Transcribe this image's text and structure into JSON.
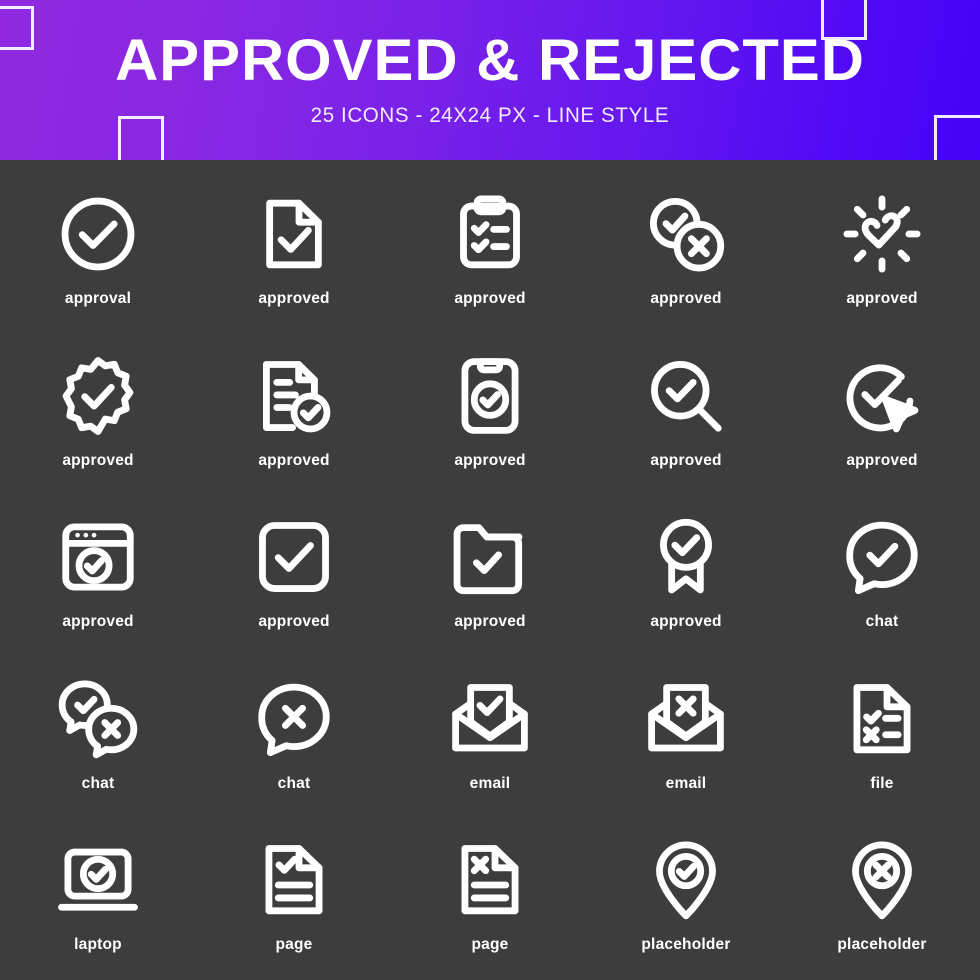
{
  "header": {
    "title": "APPROVED & REJECTED",
    "subtitle": "25 ICONS - 24X24 PX - LINE STYLE",
    "gradient_start": "#9029e0",
    "gradient_end": "#4603f7",
    "text_color": "#ffffff",
    "decorations": [
      {
        "name": "square-top-left"
      },
      {
        "name": "square-top-right"
      },
      {
        "name": "square-bottom-left"
      },
      {
        "name": "square-bottom-right"
      }
    ]
  },
  "page": {
    "background_color": "#3d3d3d",
    "icon_color": "#ffffff",
    "icon_count": 25,
    "columns": 5,
    "rows": 5
  },
  "icons": [
    {
      "label": "approval",
      "icon": "check-circle-icon"
    },
    {
      "label": "approved",
      "icon": "file-check-icon"
    },
    {
      "label": "approved",
      "icon": "clipboard-checklist-icon"
    },
    {
      "label": "approved",
      "icon": "check-cross-circles-icon"
    },
    {
      "label": "approved",
      "icon": "check-shine-burst-icon"
    },
    {
      "label": "approved",
      "icon": "badge-starburst-check-icon"
    },
    {
      "label": "approved",
      "icon": "document-lines-check-icon"
    },
    {
      "label": "approved",
      "icon": "mobile-check-icon"
    },
    {
      "label": "approved",
      "icon": "magnifier-check-icon"
    },
    {
      "label": "approved",
      "icon": "circle-check-cursor-icon"
    },
    {
      "label": "approved",
      "icon": "browser-window-check-icon"
    },
    {
      "label": "approved",
      "icon": "square-check-icon"
    },
    {
      "label": "approved",
      "icon": "folder-check-icon"
    },
    {
      "label": "approved",
      "icon": "award-ribbon-check-icon"
    },
    {
      "label": "chat",
      "icon": "chat-bubble-check-icon"
    },
    {
      "label": "chat",
      "icon": "chat-bubbles-check-cross-icon"
    },
    {
      "label": "chat",
      "icon": "chat-bubble-cross-icon"
    },
    {
      "label": "email",
      "icon": "envelope-open-check-icon"
    },
    {
      "label": "email",
      "icon": "envelope-open-cross-icon"
    },
    {
      "label": "file",
      "icon": "file-checklist-cross-icon"
    },
    {
      "label": "laptop",
      "icon": "laptop-check-icon"
    },
    {
      "label": "page",
      "icon": "page-check-lines-icon"
    },
    {
      "label": "page",
      "icon": "page-cross-lines-icon"
    },
    {
      "label": "placeholder",
      "icon": "map-pin-check-icon"
    },
    {
      "label": "placeholder",
      "icon": "map-pin-cross-icon"
    }
  ]
}
